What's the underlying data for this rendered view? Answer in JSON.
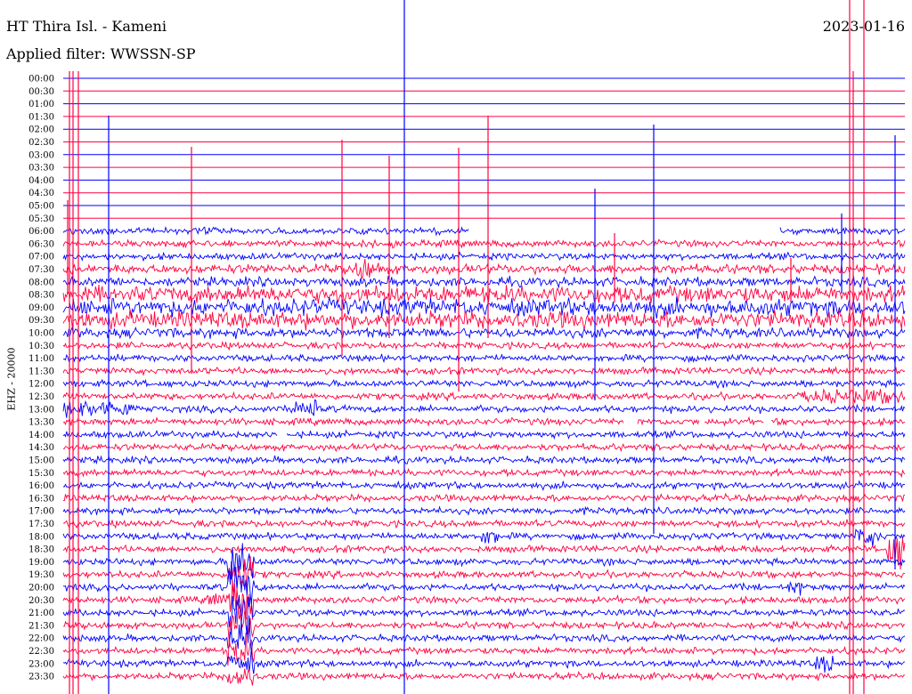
{
  "header": {
    "station": "HT Thira Isl. - Kameni",
    "date": "2023-01-16",
    "filter": "Applied filter: WWSSN-SP"
  },
  "channel_label": "EHZ - 20000",
  "colors": {
    "trace_a": "#0000ff",
    "trace_b": "#ff0040",
    "background": "#ffffff",
    "text": "#000000"
  },
  "chart_data": {
    "type": "line",
    "title": "HT Thira Isl. - Kameni",
    "subtitle": "Applied filter: WWSSN-SP",
    "ylabel": "EHZ - 20000",
    "xlabel": "",
    "rows": [
      "00:00",
      "00:30",
      "01:00",
      "01:30",
      "02:00",
      "02:30",
      "03:00",
      "03:30",
      "04:00",
      "04:30",
      "05:00",
      "05:30",
      "06:00",
      "06:30",
      "07:00",
      "07:30",
      "08:00",
      "08:30",
      "09:00",
      "09:30",
      "10:00",
      "10:30",
      "11:00",
      "11:30",
      "12:00",
      "12:30",
      "13:00",
      "13:30",
      "14:00",
      "14:30",
      "15:00",
      "15:30",
      "16:00",
      "16:30",
      "17:00",
      "17:30",
      "18:00",
      "18:30",
      "19:00",
      "19:30",
      "20:00",
      "20:30",
      "21:00",
      "21:30",
      "22:00",
      "22:30",
      "23:00",
      "23:30"
    ],
    "row_colors": [
      "trace_a",
      "trace_b"
    ],
    "quiet_until": "06:00",
    "legend": "none",
    "grid": false
  }
}
